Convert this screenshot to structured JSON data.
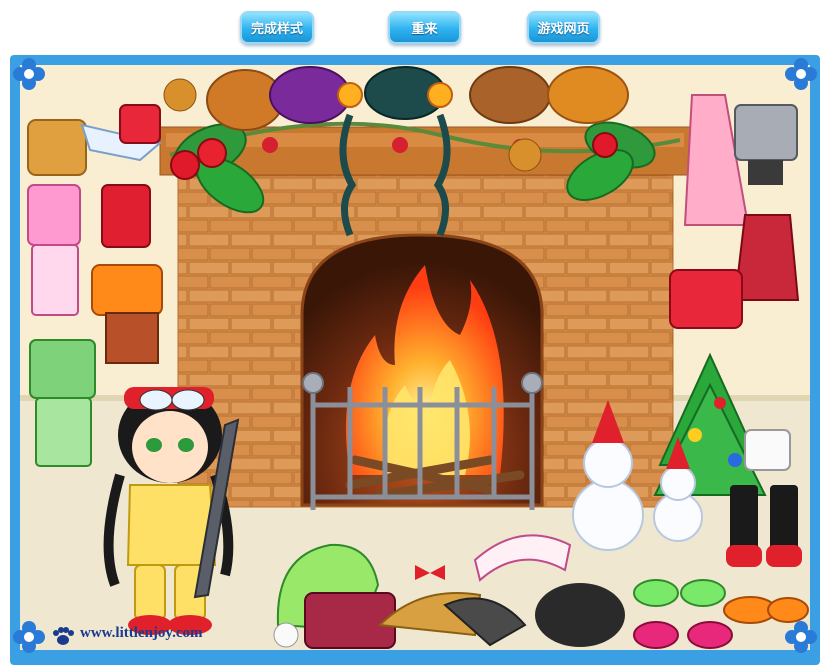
{
  "toolbar": {
    "finish_label": "完成样式",
    "reset_label": "重来",
    "website_label": "游戏网页"
  },
  "footer": {
    "url": "www.littlenjoy.com"
  },
  "colors": {
    "frame": "#3ba0e3",
    "button_top": "#8fe3ff",
    "button_bottom": "#1b95d6",
    "wall": "#f9eed2",
    "brick": "#d78a45",
    "fire": "#ff5a1a",
    "url_text": "#1a3a8f"
  },
  "icons": [
    "flower-corner-icon",
    "paw-icon",
    "coat-hanger-icon"
  ]
}
